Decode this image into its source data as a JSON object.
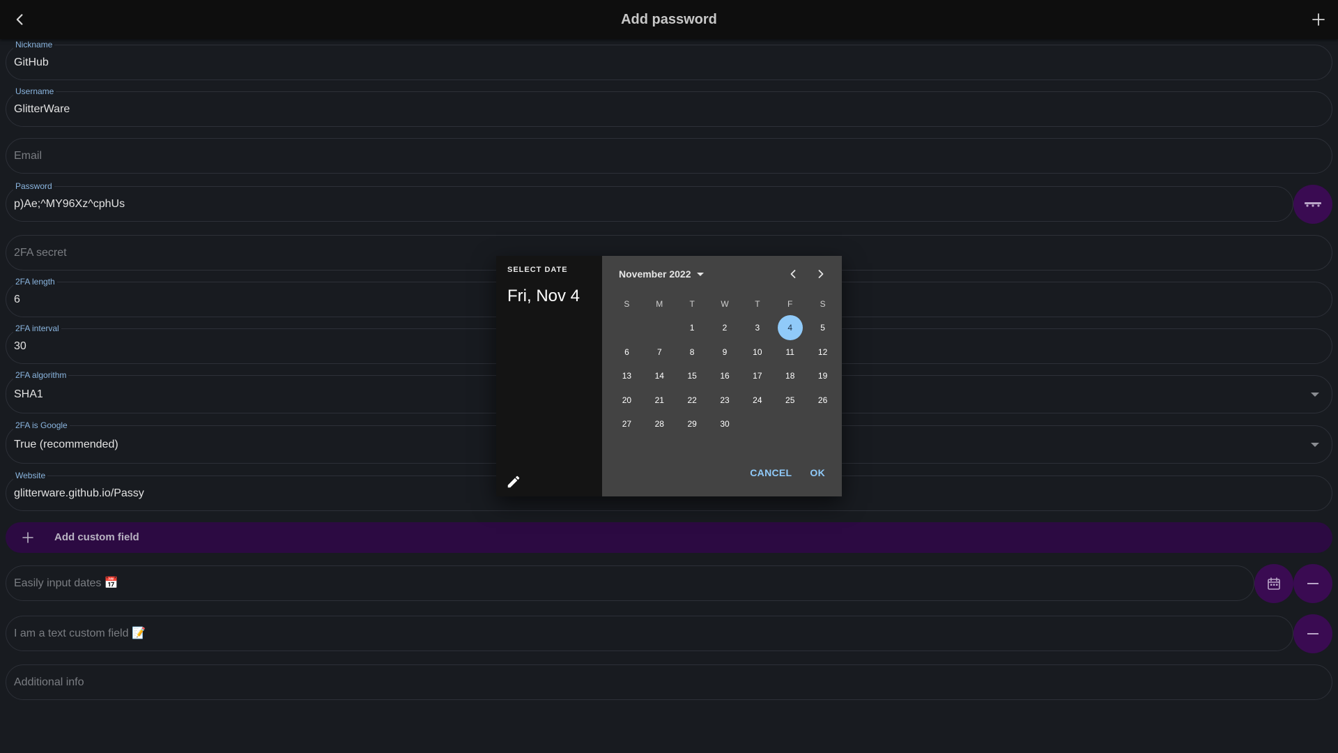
{
  "app_bar": {
    "title": "Add password",
    "back_icon": "chevron-left-icon",
    "add_icon": "plus-icon"
  },
  "fields": {
    "nickname": {
      "label": "Nickname",
      "value": "GitHub"
    },
    "username": {
      "label": "Username",
      "value": "GlitterWare"
    },
    "email": {
      "placeholder": "Email"
    },
    "password": {
      "label": "Password",
      "value": "p)Ae;^MY96Xz^cphUs"
    },
    "twofa_secret": {
      "placeholder": "2FA secret"
    },
    "twofa_length": {
      "label": "2FA length",
      "value": "6"
    },
    "twofa_interval": {
      "label": "2FA interval",
      "value": "30"
    },
    "twofa_algorithm": {
      "label": "2FA algorithm",
      "value": "SHA1"
    },
    "twofa_is_google": {
      "label": "2FA is Google",
      "value": "True (recommended)"
    },
    "website": {
      "label": "Website",
      "value": "glitterware.github.io/Passy"
    },
    "custom_date": {
      "placeholder": "Easily input dates 📅"
    },
    "custom_text": {
      "placeholder": "I am a text custom field 📝"
    },
    "additional_info": {
      "placeholder": "Additional info"
    }
  },
  "add_custom_field": {
    "label": "Add custom field"
  },
  "colors": {
    "background": "#181b20",
    "accent_purple": "#3a0b52",
    "accent_blue": "#90caf9"
  },
  "date_picker": {
    "header_label": "SELECT DATE",
    "selected_display": "Fri, Nov 4",
    "month_label": "November 2022",
    "weekdays": [
      "S",
      "M",
      "T",
      "W",
      "T",
      "F",
      "S"
    ],
    "first_weekday_index": 2,
    "days_in_month": 30,
    "selected_day": 4,
    "cancel_label": "CANCEL",
    "ok_label": "OK"
  }
}
